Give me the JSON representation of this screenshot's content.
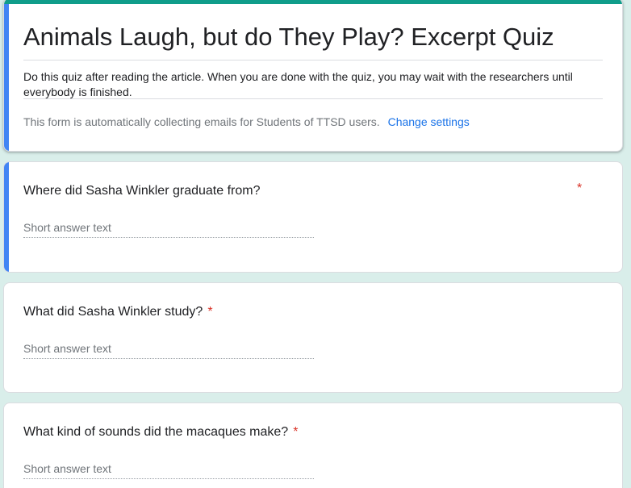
{
  "form": {
    "title": "Animals Laugh, but do They Play? Excerpt Quiz",
    "description": "Do this quiz after reading the article. When you are done with the quiz, you may wait with the researchers until everybody is finished.",
    "email_note": "This form is automatically collecting emails for Students of TTSD users.",
    "change_settings": "Change settings"
  },
  "questions": [
    {
      "title": "Where did Sasha Winkler graduate from?",
      "required_mark": "*",
      "placeholder": "Short answer text"
    },
    {
      "title": "What did Sasha Winkler study?",
      "required_mark": "*",
      "placeholder": "Short answer text"
    },
    {
      "title": "What kind of sounds did the macaques make?",
      "required_mark": "*",
      "placeholder": "Short answer text"
    }
  ],
  "colors": {
    "theme": "#0f9d8a",
    "active_accent": "#4285f4",
    "background": "#d9eeea",
    "link": "#1a73e8",
    "required": "#d93025"
  }
}
